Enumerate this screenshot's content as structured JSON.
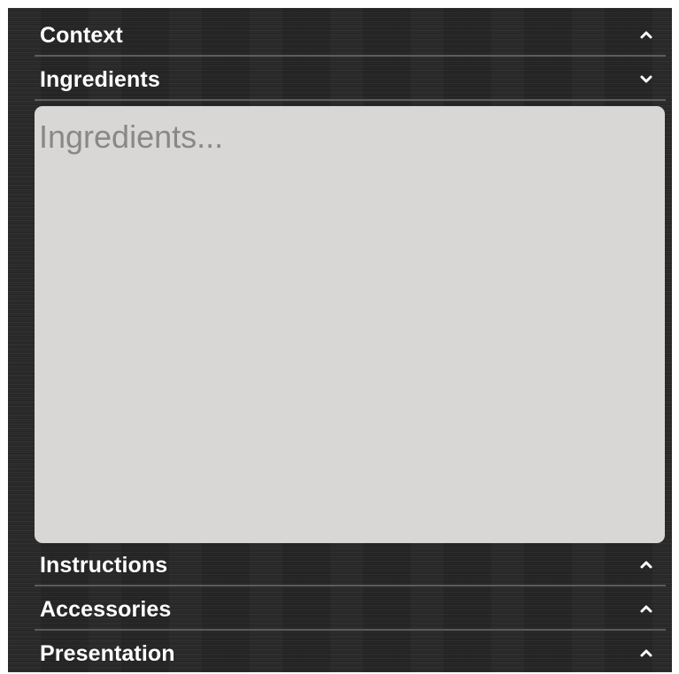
{
  "sections": [
    {
      "label": "Context",
      "expanded": false
    },
    {
      "label": "Ingredients",
      "expanded": true
    },
    {
      "label": "Instructions",
      "expanded": false
    },
    {
      "label": "Accessories",
      "expanded": false
    },
    {
      "label": "Presentation",
      "expanded": false
    }
  ],
  "ingredients_field": {
    "placeholder": "Ingredients...",
    "value": ""
  },
  "icons": {
    "collapsed": "chevron-up-icon",
    "expanded": "chevron-down-icon"
  },
  "colors": {
    "panel_background": "#262626",
    "header_text": "#ffffff",
    "divider": "#5c5c5c",
    "field_background": "#d9d7d5",
    "placeholder_text": "#8a8886"
  }
}
